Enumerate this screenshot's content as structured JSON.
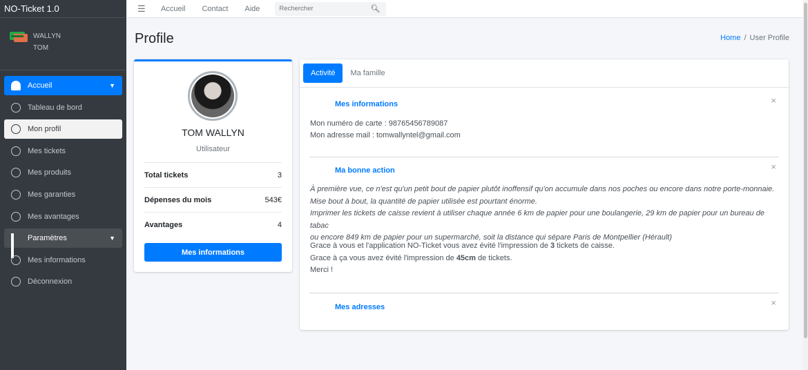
{
  "app": {
    "title": "NO-Ticket 1.0"
  },
  "user": {
    "first": "WALLYN",
    "last": "TOM"
  },
  "sidebar": {
    "items": [
      {
        "label": "Accueil",
        "icon": "dashboard-icon"
      },
      {
        "label": "Tableau de bord",
        "icon": "circle-icon"
      },
      {
        "label": "Mon profil",
        "icon": "circle-icon"
      },
      {
        "label": "Mes tickets",
        "icon": "circle-icon"
      },
      {
        "label": "Mes produits",
        "icon": "circle-icon"
      },
      {
        "label": "Mes garanties",
        "icon": "circle-icon"
      },
      {
        "label": "Mes avantages",
        "icon": "circle-icon"
      },
      {
        "label": "Paramètres",
        "icon": "grid-icon"
      },
      {
        "label": "Mes informations",
        "icon": "circle-icon"
      },
      {
        "label": "Déconnexion",
        "icon": "circle-icon"
      }
    ]
  },
  "topbar": {
    "links": [
      "Accueil",
      "Contact",
      "Aide"
    ],
    "search_placeholder": "Rechercher"
  },
  "page": {
    "title": "Profile",
    "breadcrumb": {
      "home": "Home",
      "sep": "/",
      "current": "User Profile"
    }
  },
  "profile": {
    "name": "TOM WALLYN",
    "role": "Utilisateur",
    "stats": [
      {
        "label": "Total tickets",
        "value": "3"
      },
      {
        "label": "Dépenses du mois",
        "value": "543€"
      },
      {
        "label": "Avantages",
        "value": "4"
      }
    ],
    "button": "Mes informations"
  },
  "tabs": [
    "Activité",
    "Ma famille"
  ],
  "sections": {
    "info": {
      "title": "Mes informations",
      "card_label": "Mon numéro de carte : ",
      "card_value": "98765456789087",
      "mail_label": "Mon adresse mail : ",
      "mail_value": "tomwallyntel@gmail.com"
    },
    "action": {
      "title": "Ma bonne action",
      "p1": "À première vue, ce n'est qu'un petit bout de papier plutôt inoffensif qu'on accumule dans nos poches ou encore dans notre porte-monnaie.",
      "p2": "Mise bout à bout, la quantité de papier utilisée est pourtant énorme.",
      "p3": "Imprimer les tickets de caisse revient à utiliser chaque année 6 km de papier pour une boulangerie, 29 km de papier pour un bureau de tabac",
      "p4": "ou encore 849 km de papier pour un supermarché, soit la distance qui sépare Paris de Montpellier (Hérault)",
      "g1a": "Grace à vous et l'application NO-Ticket vous avez évité l'impression de ",
      "g1b": "3",
      "g1c": " tickets de caisse.",
      "g2a": "Grace à ça vous avez évité l'impression de ",
      "g2b": "45cm",
      "g2c": " de tickets.",
      "g3": "Merci !"
    },
    "addresses": {
      "title": "Mes adresses"
    },
    "close": "×"
  }
}
